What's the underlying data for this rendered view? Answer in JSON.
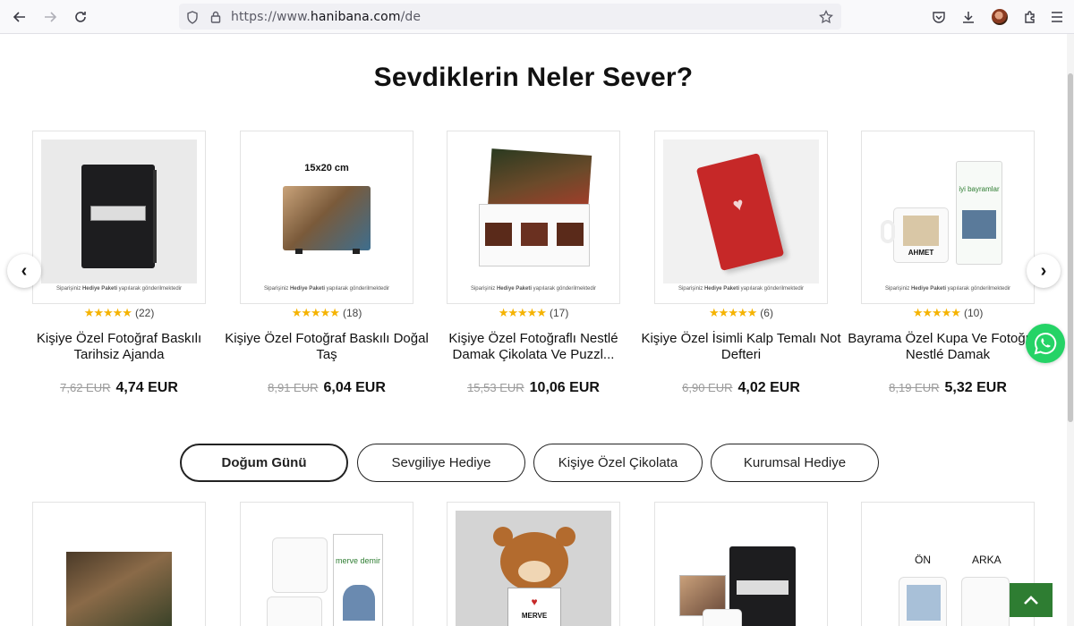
{
  "browser": {
    "url_prefix": "https://www.",
    "url_domain": "hanibana.com",
    "url_path": "/de"
  },
  "section_title": "Sevdiklerin Neler Sever?",
  "card_caption": {
    "pre": "Siparişiniz ",
    "bold": "Hediye Paketi",
    "post": " yapılarak gönderilmektedir"
  },
  "products": [
    {
      "name": "Kişiye Özel Fotoğraf Baskılı Tarihsiz Ajanda",
      "reviews": "(22)",
      "old_price": "7,62 EUR",
      "price": "4,74 EUR",
      "rating": 5
    },
    {
      "name": "Kişiye Özel Fotoğraf Baskılı Doğal Taş",
      "reviews": "(18)",
      "old_price": "8,91 EUR",
      "price": "6,04 EUR",
      "rating": 5,
      "image_label": "15x20 cm"
    },
    {
      "name": "Kişiye Özel Fotoğraflı Nestlé Damak Çikolata Ve Puzzl...",
      "reviews": "(17)",
      "old_price": "15,53 EUR",
      "price": "10,06 EUR",
      "rating": 5
    },
    {
      "name": "Kişiye Özel İsimli Kalp Temalı Not Defteri",
      "reviews": "(6)",
      "old_price": "6,90 EUR",
      "price": "4,02 EUR",
      "rating": 5
    },
    {
      "name": "Bayrama Özel Kupa Ve Fotoğraflı Nestlé Damak",
      "reviews": "(10)",
      "old_price": "8,19 EUR",
      "price": "5,32 EUR",
      "rating": 5,
      "image_label": "iyi bayramlar",
      "image_name": "AHMET"
    }
  ],
  "tabs": [
    {
      "label": "Doğum Günü",
      "active": true
    },
    {
      "label": "Sevgiliye Hediye",
      "active": false
    },
    {
      "label": "Kişiye Özel Çikolata",
      "active": false
    },
    {
      "label": "Kurumsal Hediye",
      "active": false
    }
  ],
  "bottom_cards": [
    {
      "image_text": ""
    },
    {
      "image_text": "merve demir"
    },
    {
      "image_text": "MERVE"
    },
    {
      "image_text": ""
    },
    {
      "front_label": "ÖN",
      "back_label": "ARKA"
    }
  ],
  "colors": {
    "accent_green": "#2e7d32",
    "whatsapp": "#25d366",
    "star": "#f5b301"
  }
}
